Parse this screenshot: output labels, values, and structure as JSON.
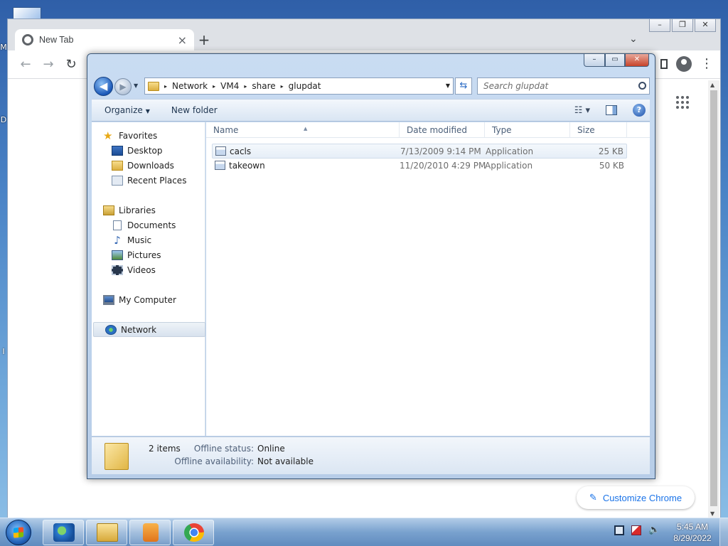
{
  "desktop": {
    "side_letters": [
      "M",
      "D",
      "I"
    ]
  },
  "chrome": {
    "tab_title": "New Tab",
    "tab_close": "×",
    "new_tab": "+",
    "tab_search": "⌄",
    "win_min": "–",
    "win_max": "❐",
    "win_close": "✕",
    "back": "←",
    "forward": "→",
    "reload": "↻",
    "menu": "⋮",
    "customize_label": "Customize Chrome"
  },
  "explorer": {
    "caption": {
      "min": "–",
      "max": "▭",
      "close": "✕"
    },
    "address": {
      "crumbs": [
        "Network",
        "VM4",
        "share",
        "glupdat"
      ],
      "separator": "▸",
      "dropdown": "▼"
    },
    "refresh_glyph": "⇆",
    "search": {
      "placeholder": "Search glupdat"
    },
    "command_bar": {
      "organize": "Organize",
      "organize_caret": "▼",
      "new_folder": "New folder",
      "views_glyph": "☷ ▾",
      "help_glyph": "?"
    },
    "nav": {
      "favorites": "Favorites",
      "desktop": "Desktop",
      "downloads": "Downloads",
      "recent_places": "Recent Places",
      "libraries": "Libraries",
      "documents": "Documents",
      "music": "Music",
      "pictures": "Pictures",
      "videos": "Videos",
      "my_computer": "My Computer",
      "network": "Network"
    },
    "columns": {
      "name": "Name",
      "date_modified": "Date modified",
      "type": "Type",
      "size": "Size",
      "sort_glyph": "▲"
    },
    "files": [
      {
        "name": "cacls",
        "date": "7/13/2009 9:14 PM",
        "type": "Application",
        "size": "25 KB"
      },
      {
        "name": "takeown",
        "date": "11/20/2010 4:29 PM",
        "type": "Application",
        "size": "50 KB"
      }
    ],
    "details": {
      "item_count": "2 items",
      "offline_status_label": "Offline status:",
      "offline_status_value": "Online",
      "offline_availability_label": "Offline availability:",
      "offline_availability_value": "Not available"
    }
  },
  "taskbar": {
    "time": "5:45 AM",
    "date": "8/29/2022",
    "volume_glyph": "🔈"
  }
}
